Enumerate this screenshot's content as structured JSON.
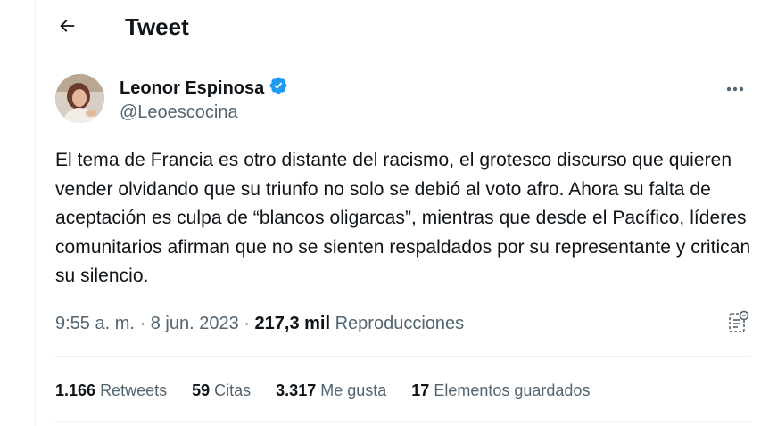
{
  "header": {
    "title": "Tweet",
    "back_icon": "arrow-left-icon"
  },
  "author": {
    "display_name": "Leonor Espinosa",
    "handle": "@Leoescocina",
    "verified_icon": "verified-badge-icon",
    "verified_color": "#1d9bf0"
  },
  "tweet": {
    "text": "El tema de Francia es otro distante del racismo, el grotesco discurso que quieren vender olvidando que su triunfo no solo se debió al voto afro. Ahora su falta de aceptación es culpa de “blancos oligarcas”, mientras que desde el Pacífico, líderes comunitarios afirman que no se sienten respaldados por su representante y critican su silencio."
  },
  "meta": {
    "time": "9:55 a. m.",
    "separator": "·",
    "date": "8 jun. 2023",
    "views_count": "217,3 mil",
    "views_label": "Reproducciones"
  },
  "stats": [
    {
      "count": "1.166",
      "label": "Retweets"
    },
    {
      "count": "59",
      "label": "Citas"
    },
    {
      "count": "3.317",
      "label": "Me gusta"
    },
    {
      "count": "17",
      "label": "Elementos guardados"
    }
  ],
  "colors": {
    "text": "#0f1419",
    "secondary": "#536471",
    "border": "#eff3f4"
  }
}
